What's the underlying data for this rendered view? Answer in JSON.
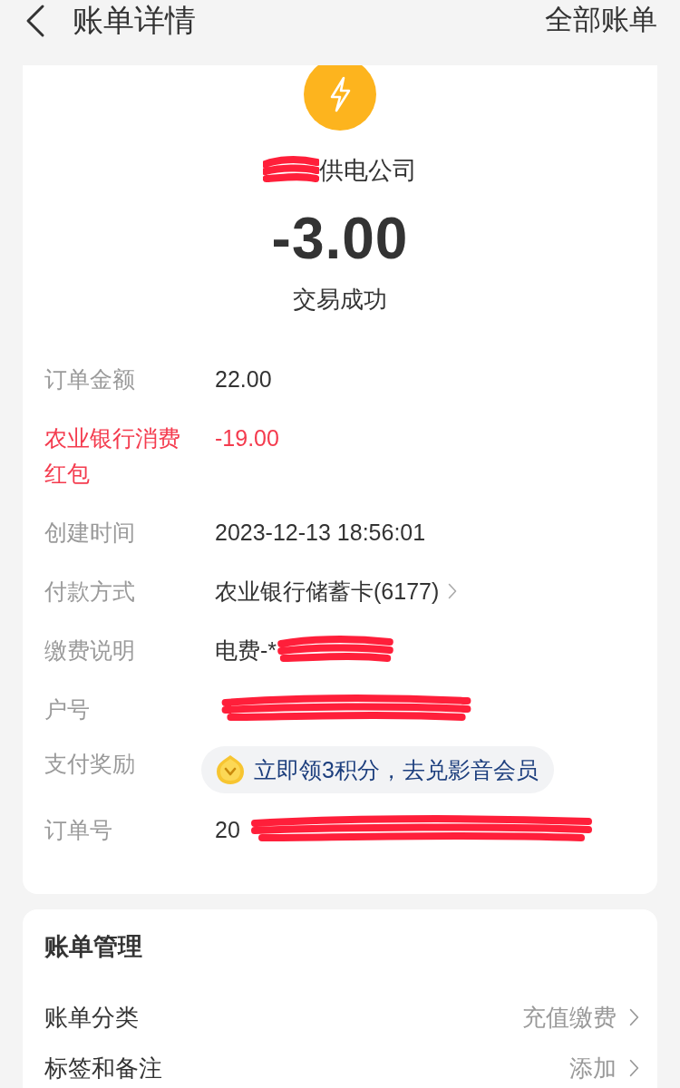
{
  "header": {
    "title": "账单详情",
    "action": "全部账单"
  },
  "summary": {
    "merchant": {
      "name": "供电公司",
      "redacted": true
    },
    "amount": "-3.00",
    "status": "交易成功"
  },
  "details": [
    {
      "label": "订单金额",
      "value": "22.00",
      "kind": "text",
      "redacted": false
    },
    {
      "label": "农业银行消费红包",
      "value": "-19.00",
      "kind": "discount",
      "redacted": false
    },
    {
      "label": "创建时间",
      "value": "2023-12-13 18:56:01",
      "kind": "text",
      "redacted": false
    },
    {
      "label": "付款方式",
      "value": "农业银行储蓄卡(6177)",
      "kind": "link",
      "redacted": false
    },
    {
      "label": "缴费说明",
      "value": "电费-*",
      "kind": "text",
      "redacted": true
    },
    {
      "label": "户号",
      "kind": "text",
      "redacted": true
    },
    {
      "label": "支付奖励",
      "value": "立即领3积分，去兑影音会员",
      "kind": "reward",
      "redacted": false
    },
    {
      "label": "订单号",
      "value": "20",
      "kind": "text",
      "redacted": true
    }
  ],
  "management": {
    "title": "账单管理",
    "items": [
      {
        "label": "账单分类",
        "value": "充值缴费"
      },
      {
        "label": "标签和备注",
        "value": "添加"
      }
    ]
  }
}
